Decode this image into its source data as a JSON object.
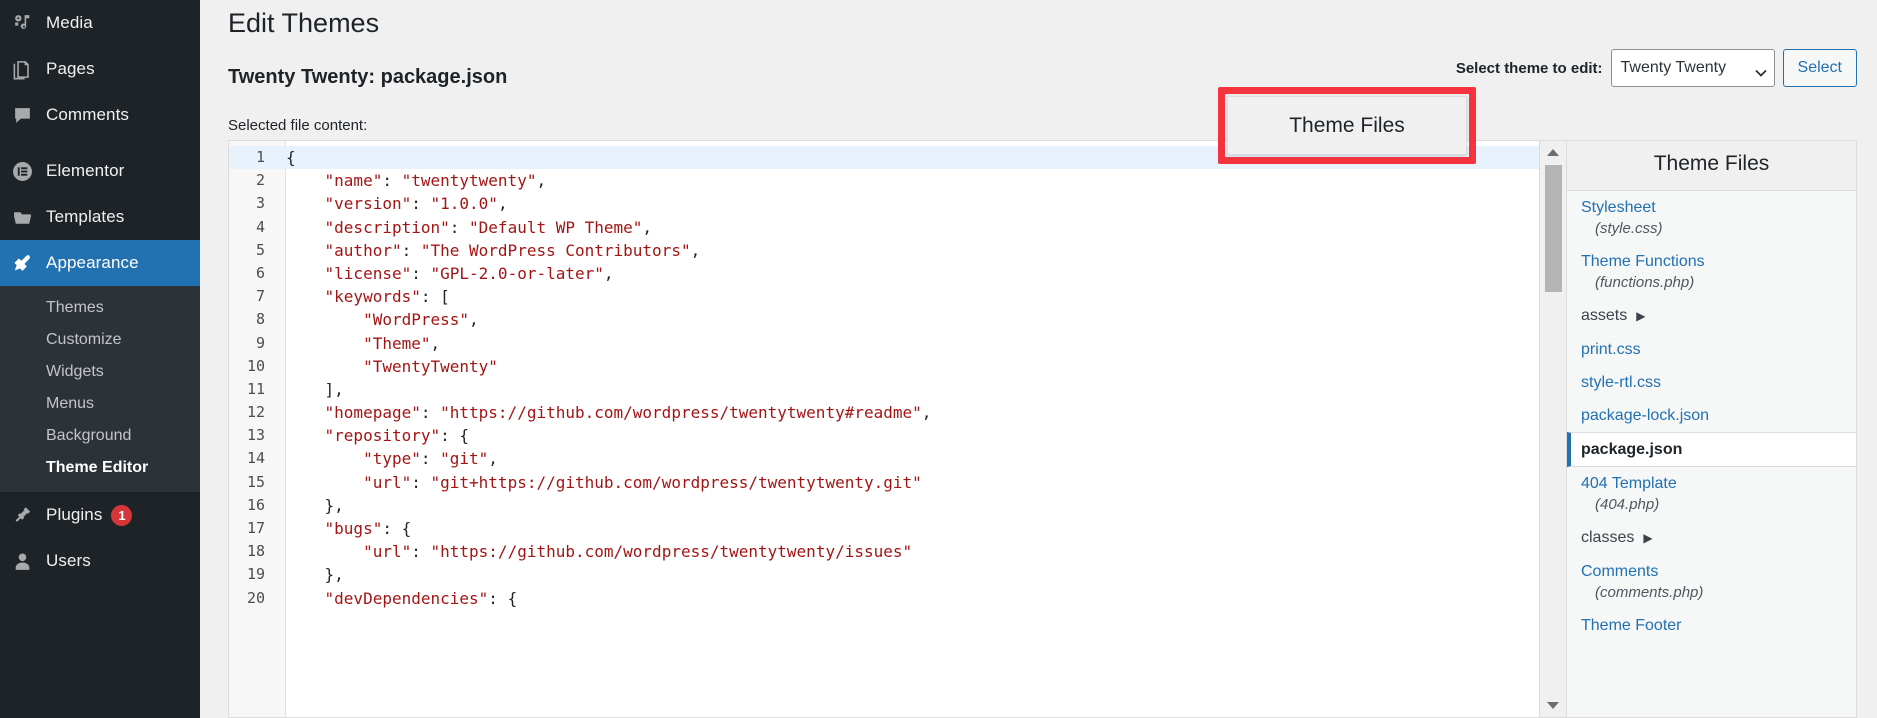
{
  "sidebar": {
    "items": [
      {
        "label": "Media",
        "icon": "media-icon",
        "active": false
      },
      {
        "label": "Pages",
        "icon": "pages-icon",
        "active": false
      },
      {
        "label": "Comments",
        "icon": "comments-icon",
        "active": false
      },
      {
        "label": "Elementor",
        "icon": "elementor-icon",
        "active": false
      },
      {
        "label": "Templates",
        "icon": "templates-folder-icon",
        "active": false
      },
      {
        "label": "Appearance",
        "icon": "appearance-brush-icon",
        "active": true
      },
      {
        "label": "Plugins",
        "icon": "plugins-plug-icon",
        "badge": "1",
        "active": false
      },
      {
        "label": "Users",
        "icon": "users-person-icon",
        "active": false
      }
    ],
    "appearance_submenu": [
      {
        "label": "Themes",
        "current": false
      },
      {
        "label": "Customize",
        "current": false
      },
      {
        "label": "Widgets",
        "current": false
      },
      {
        "label": "Menus",
        "current": false
      },
      {
        "label": "Background",
        "current": false
      },
      {
        "label": "Theme Editor",
        "current": true
      }
    ]
  },
  "header": {
    "page_title": "Edit Themes",
    "file_heading": "Twenty Twenty: package.json",
    "selected_file_label": "Selected file content:"
  },
  "theme_chooser": {
    "label": "Select theme to edit:",
    "selected_theme": "Twenty Twenty",
    "select_button": "Select",
    "chevron_icon": "chevron-down-icon"
  },
  "annotation": {
    "text": "Theme Files",
    "color": "#f5333f"
  },
  "editor": {
    "active_line": 1,
    "lines": [
      {
        "num": "1",
        "text": "{"
      },
      {
        "num": "2",
        "text": "    \"name\": \"twentytwenty\","
      },
      {
        "num": "3",
        "text": "    \"version\": \"1.0.0\","
      },
      {
        "num": "4",
        "text": "    \"description\": \"Default WP Theme\","
      },
      {
        "num": "5",
        "text": "    \"author\": \"The WordPress Contributors\","
      },
      {
        "num": "6",
        "text": "    \"license\": \"GPL-2.0-or-later\","
      },
      {
        "num": "7",
        "text": "    \"keywords\": ["
      },
      {
        "num": "8",
        "text": "        \"WordPress\","
      },
      {
        "num": "9",
        "text": "        \"Theme\","
      },
      {
        "num": "10",
        "text": "        \"TwentyTwenty\""
      },
      {
        "num": "11",
        "text": "    ],"
      },
      {
        "num": "12",
        "text": "    \"homepage\": \"https://github.com/wordpress/twentytwenty#readme\","
      },
      {
        "num": "13",
        "text": "    \"repository\": {"
      },
      {
        "num": "14",
        "text": "        \"type\": \"git\","
      },
      {
        "num": "15",
        "text": "        \"url\": \"git+https://github.com/wordpress/twentytwenty.git\""
      },
      {
        "num": "16",
        "text": "    },"
      },
      {
        "num": "17",
        "text": "    \"bugs\": {"
      },
      {
        "num": "18",
        "text": "        \"url\": \"https://github.com/wordpress/twentytwenty/issues\""
      },
      {
        "num": "19",
        "text": "    },"
      },
      {
        "num": "20",
        "text": "    \"devDependencies\": {"
      }
    ]
  },
  "file_panel": {
    "title": "Theme Files",
    "files": [
      {
        "name": "Stylesheet",
        "sub": "(style.css)",
        "type": "file",
        "selected": false
      },
      {
        "name": "Theme Functions",
        "sub": "(functions.php)",
        "type": "file",
        "selected": false
      },
      {
        "name": "assets",
        "sub": "",
        "type": "folder",
        "selected": false
      },
      {
        "name": "print.css",
        "sub": "",
        "type": "file",
        "selected": false
      },
      {
        "name": "style-rtl.css",
        "sub": "",
        "type": "file",
        "selected": false
      },
      {
        "name": "package-lock.json",
        "sub": "",
        "type": "file",
        "selected": false
      },
      {
        "name": "package.json",
        "sub": "",
        "type": "file",
        "selected": true
      },
      {
        "name": "404 Template",
        "sub": "(404.php)",
        "type": "file",
        "selected": false
      },
      {
        "name": "classes",
        "sub": "",
        "type": "folder",
        "selected": false
      },
      {
        "name": "Comments",
        "sub": "(comments.php)",
        "type": "file",
        "selected": false
      },
      {
        "name": "Theme Footer",
        "sub": "",
        "type": "file",
        "selected": false
      }
    ],
    "folder_caret": "▶"
  },
  "colors": {
    "sidebar_bg": "#1d2327",
    "accent_blue": "#2271b1",
    "annotation_red": "#f5333f",
    "string_red": "#a31515"
  }
}
